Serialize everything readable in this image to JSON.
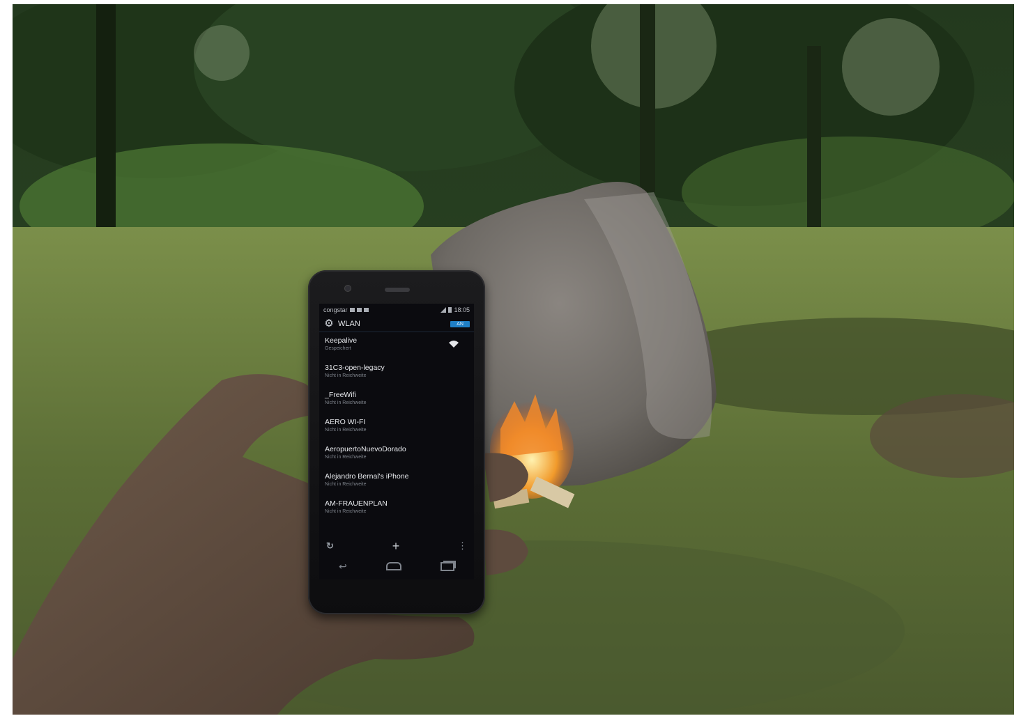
{
  "status_bar": {
    "carrier": "congstar",
    "time": "18:05"
  },
  "action_bar": {
    "title": "WLAN",
    "toggle": "AN",
    "icon": "gear-icon"
  },
  "networks": [
    {
      "name": "Keepalive",
      "status": "Gespeichert",
      "signal": true
    },
    {
      "name": "31C3-open-legacy",
      "status": "Nicht in Reichweite",
      "signal": false
    },
    {
      "name": "_FreeWifi",
      "status": "Nicht in Reichweite",
      "signal": false
    },
    {
      "name": "AERO WI-FI",
      "status": "Nicht in Reichweite",
      "signal": false
    },
    {
      "name": "AeropuertoNuevoDorado",
      "status": "Nicht in Reichweite",
      "signal": false
    },
    {
      "name": "Alejandro Bernal's iPhone",
      "status": "Nicht in Reichweite",
      "signal": false
    },
    {
      "name": "AM-FRAUENPLAN",
      "status": "Nicht in Reichweite",
      "signal": false
    }
  ],
  "bottom_bar": {
    "left_icon": "wps-icon",
    "center_icon": "add-icon",
    "right_icon": "menu-icon"
  },
  "navigation": [
    "back-icon",
    "home-icon",
    "recent-apps-icon"
  ],
  "colors": {
    "accent": "#1f7fc6",
    "screen_bg": "#0b0b0f"
  }
}
